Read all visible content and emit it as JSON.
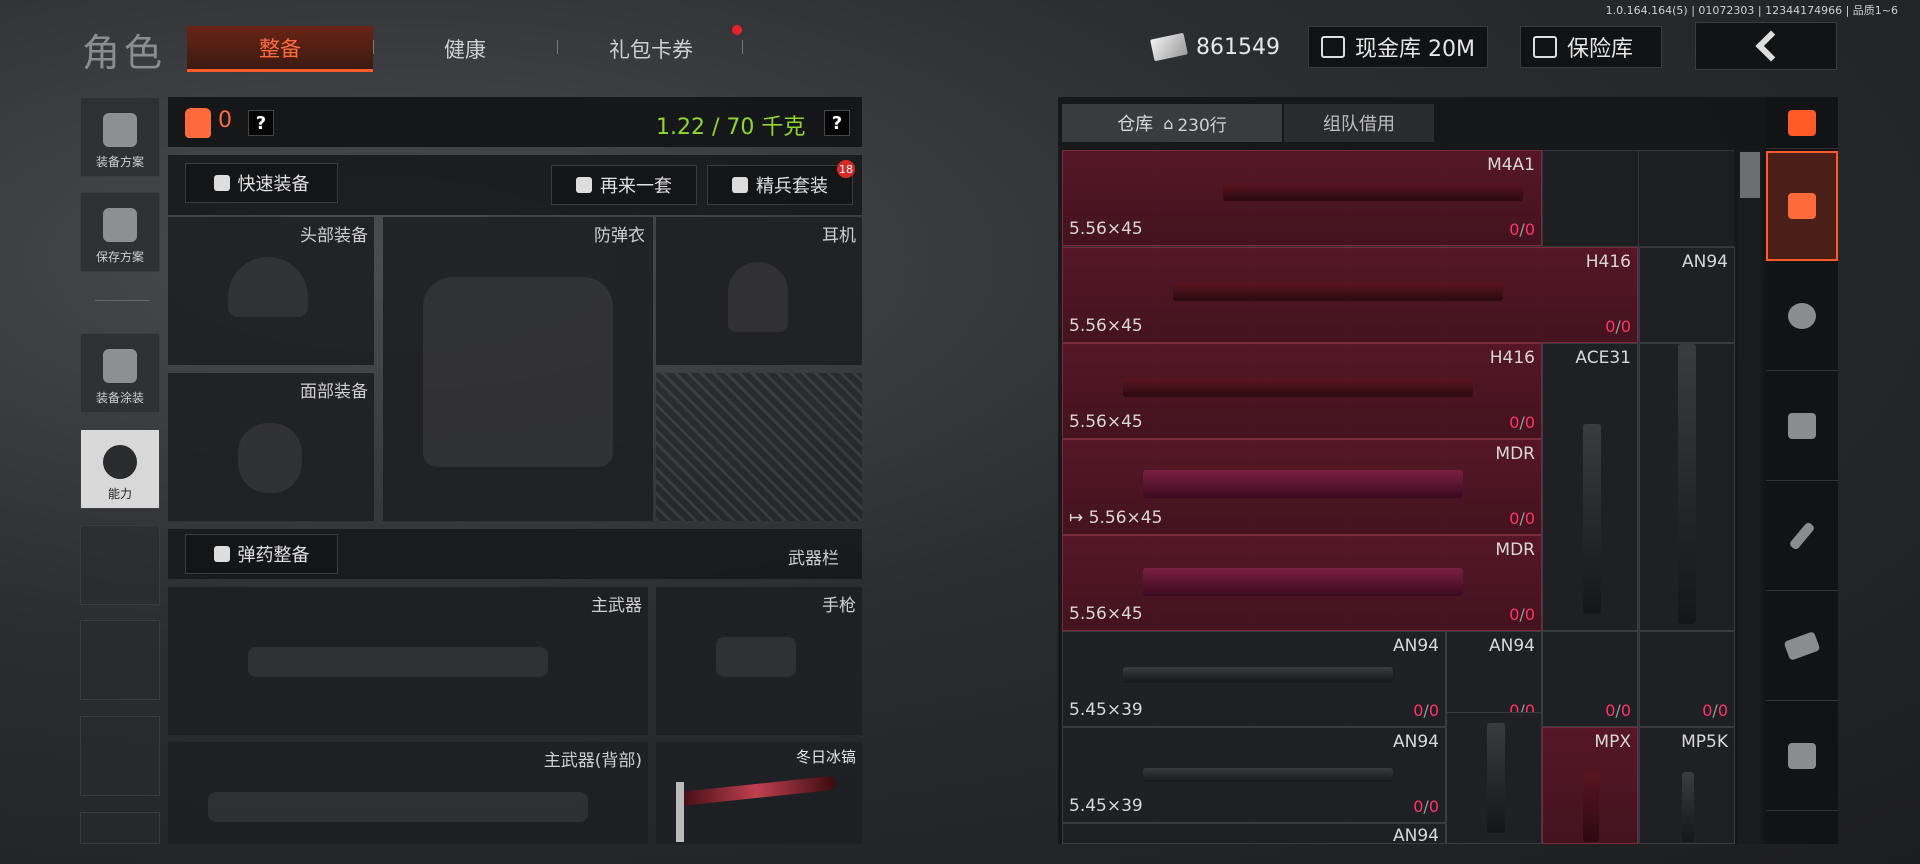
{
  "version": "1.0.164.164(5) | 01072303 | 12344174966 | 品质1~6",
  "page_title": "角色",
  "tabs": [
    {
      "label": "整备",
      "active": true
    },
    {
      "label": "健康",
      "active": false
    },
    {
      "label": "礼包卡券",
      "active": false,
      "notification": true
    }
  ],
  "currency": {
    "cash": "861549",
    "cash_vault": "现金库 20M",
    "safe": "保险库"
  },
  "sidebar": [
    {
      "label": "装备方案",
      "icon": "vest-icon"
    },
    {
      "label": "保存方案",
      "icon": "download-icon"
    },
    {
      "label": "装备涂装",
      "icon": "helmet-icon"
    },
    {
      "label": "能力",
      "icon": "ability-icon",
      "active": true
    }
  ],
  "equipment": {
    "armor_count": "0",
    "weight": "1.22 / 70 千克",
    "quick_equip": "快速装备",
    "reroll": "再来一套",
    "elite_set": "精兵套装",
    "elite_badge": "18",
    "slots": {
      "head": "头部装备",
      "armor": "防弹衣",
      "earphone": "耳机",
      "face": "面部装备",
      "ammo": "弹药整备",
      "weapon_bar": "武器栏",
      "primary": "主武器",
      "pistol": "手枪",
      "primary_back": "主武器(背部)",
      "melee": "冬日冰镐"
    }
  },
  "warehouse": {
    "tab_warehouse": "仓库",
    "rows": "230行",
    "tab_team": "组队借用",
    "items": [
      {
        "name": "M4A1",
        "caliber": "5.56×45",
        "ammo": "0",
        "ammo_max": "0"
      },
      {
        "name": "H416",
        "caliber": "5.56×45",
        "ammo": "0",
        "ammo_max": "0"
      },
      {
        "name": "AN94",
        "caliber": "",
        "ammo": "",
        "ammo_max": ""
      },
      {
        "name": "H416",
        "caliber": "5.56×45",
        "ammo": "0",
        "ammo_max": "0"
      },
      {
        "name": "ACE31",
        "caliber": "",
        "ammo": "",
        "ammo_max": ""
      },
      {
        "name": "MDR",
        "caliber": "5.56×45",
        "ammo": "0",
        "ammo_max": "0",
        "equipped_arrow": "↦"
      },
      {
        "name": "MDR",
        "caliber": "5.56×45",
        "ammo": "0",
        "ammo_max": "0"
      },
      {
        "name": "AN94",
        "caliber": "5.45×39",
        "ammo": "0",
        "ammo_max": "0"
      },
      {
        "name": "AN94",
        "caliber": "",
        "ammo": "0",
        "ammo_max": "0"
      },
      {
        "name": "",
        "caliber": "",
        "ammo": "0",
        "ammo_max": "0"
      },
      {
        "name": "",
        "caliber": "",
        "ammo": "0",
        "ammo_max": "0"
      },
      {
        "name": "AN94",
        "caliber": "5.45×39",
        "ammo": "0",
        "ammo_max": "0"
      },
      {
        "name": "MPX",
        "caliber": "",
        "ammo": "",
        "ammo_max": ""
      },
      {
        "name": "MP5K",
        "caliber": "",
        "ammo": "",
        "ammo_max": ""
      },
      {
        "name": "AN94",
        "caliber": "",
        "ammo": "",
        "ammo_max": ""
      }
    ]
  },
  "categories": [
    "all-items-icon",
    "grenade-icon",
    "medkit-icon",
    "key-icon",
    "cash-icon",
    "box-icon"
  ],
  "colors": {
    "accent": "#ff5a28",
    "weight_ok": "#8fd630",
    "ammo_zero": "#ff3366",
    "item_red": "#5a1626"
  }
}
